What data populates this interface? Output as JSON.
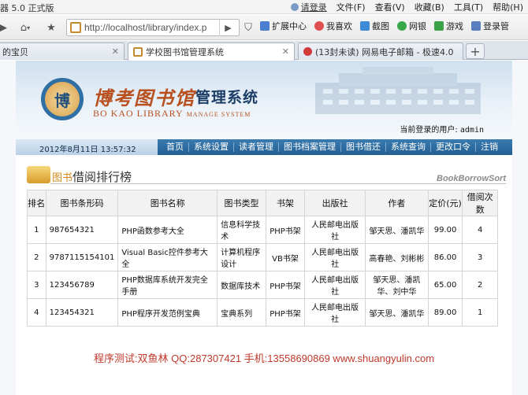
{
  "window": {
    "title": "器 5.0 正式版",
    "menus": [
      {
        "label": "请登录"
      },
      {
        "label": "文件(F)"
      },
      {
        "label": "查看(V)"
      },
      {
        "label": "收藏(B)"
      },
      {
        "label": "工具(T)"
      },
      {
        "label": "帮助(H)"
      }
    ]
  },
  "navbar": {
    "url": "http://localhost/library/index.p",
    "toolbar": [
      {
        "label": "扩展中心"
      },
      {
        "label": "我喜欢"
      },
      {
        "label": "截图"
      },
      {
        "label": "网银"
      },
      {
        "label": "游戏"
      },
      {
        "label": "登录管"
      }
    ]
  },
  "tabs": [
    {
      "label": "的宝贝"
    },
    {
      "label": "学校图书馆管理系统"
    },
    {
      "label": "(13封未读) 网易电子邮箱 - 极速4.0"
    }
  ],
  "header": {
    "logo_char": "博",
    "logo_cn": "博考图书馆",
    "logo_system": "管理系统",
    "logo_en": "BO KAO LIBRARY",
    "logo_en_sub": "MANAGE SYSTEM",
    "current_user_label": "当前登录的用户:",
    "current_user": "admin",
    "datetime": "2012年8月11日 13:57:32"
  },
  "nav": [
    {
      "label": "首页"
    },
    {
      "label": "系统设置"
    },
    {
      "label": "读者管理"
    },
    {
      "label": "图书档案管理"
    },
    {
      "label": "图书借还"
    },
    {
      "label": "系统查询"
    },
    {
      "label": "更改口令"
    },
    {
      "label": "注销"
    }
  ],
  "section": {
    "title_highlight": "图书",
    "title": "借阅排行榜",
    "english": "BookBorrowSort"
  },
  "table": {
    "headers": [
      "排名",
      "图书条形码",
      "图书名称",
      "图书类型",
      "书架",
      "出版社",
      "作者",
      "定价(元)",
      "借阅次数"
    ],
    "rows": [
      [
        "1",
        "987654321",
        "PHP函数参考大全",
        "信息科学技术",
        "PHP书架",
        "人民邮电出版社",
        "邹天思、潘凯华",
        "99.00",
        "4"
      ],
      [
        "2",
        "9787115154101",
        "Visual Basic控件参考大全",
        "计算机程序设计",
        "VB书架",
        "人民邮电出版社",
        "高春艳、刘彬彬",
        "86.00",
        "3"
      ],
      [
        "3",
        "123456789",
        "PHP数据库系统开发完全手册",
        "数据库技术",
        "PHP书架",
        "人民邮电出版社",
        "邹天思、潘凯华、刘中华",
        "65.00",
        "2"
      ],
      [
        "4",
        "123454321",
        "PHP程序开发范例宝典",
        "宝典系列",
        "PHP书架",
        "人民邮电出版社",
        "邹天思、潘凯华",
        "89.00",
        "1"
      ]
    ]
  },
  "footer": {
    "note": "程序测试:双鱼林 QQ:287307421 手机:13558690869 www.shuangyulin.com"
  }
}
